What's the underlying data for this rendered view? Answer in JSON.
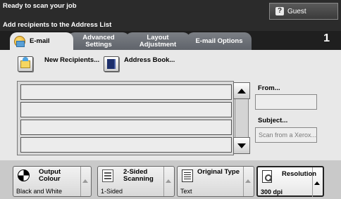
{
  "header": {
    "status": "Ready to scan your job",
    "instruction": "Add recipients to the Address List",
    "guest_label": "Guest",
    "job_count": "1"
  },
  "tabs": [
    {
      "label": "E-mail",
      "selected": true
    },
    {
      "label": "Advanced Settings",
      "selected": false
    },
    {
      "label": "Layout Adjustment",
      "selected": false
    },
    {
      "label": "E-mail Options",
      "selected": false
    }
  ],
  "actions": {
    "new_recipients": "New Recipients...",
    "address_book": "Address Book..."
  },
  "recipient_list": {
    "rows": [
      "",
      "",
      "",
      ""
    ]
  },
  "fields": {
    "from_label": "From...",
    "from_value": "",
    "subject_label": "Subject...",
    "subject_value": "Scan from a Xerox..."
  },
  "options": [
    {
      "title": "Output Colour",
      "value": "Black and White",
      "icon": "colour-circle-icon"
    },
    {
      "title": "2-Sided Scanning",
      "value": "1-Sided",
      "icon": "document-sided-icon"
    },
    {
      "title": "Original Type",
      "value": "Text",
      "icon": "text-document-icon"
    },
    {
      "title": "Resolution",
      "value": "300 dpi",
      "icon": "resolution-icon",
      "selected": true
    }
  ],
  "colors": {
    "header_bg": "#2b2b2b",
    "tab_inactive": "#6d7177",
    "panel_bg": "#e8e8e8"
  }
}
